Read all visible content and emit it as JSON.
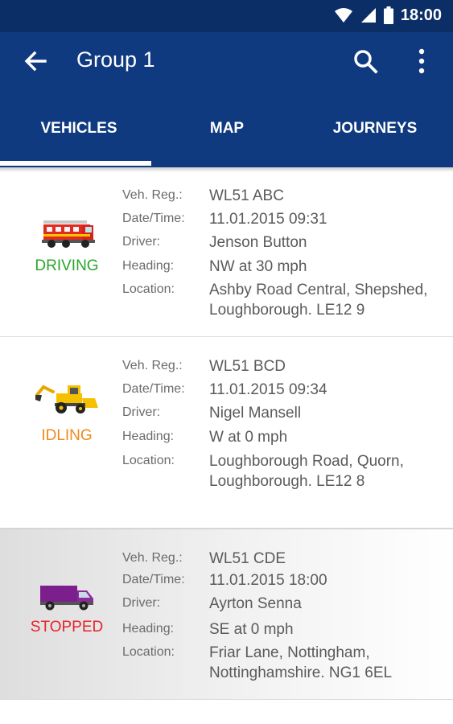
{
  "status_bar": {
    "time": "18:00",
    "icons": [
      "wifi-icon",
      "signal-icon",
      "battery-icon"
    ]
  },
  "app_bar": {
    "title": "Group 1",
    "back_icon": "arrow-back-icon",
    "search_icon": "search-icon",
    "menu_icon": "more-vert-icon"
  },
  "tabs": [
    {
      "label": "VEHICLES",
      "active": true
    },
    {
      "label": "MAP",
      "active": false
    },
    {
      "label": "JOURNEYS",
      "active": false
    }
  ],
  "field_labels": {
    "reg": "Veh. Reg.:",
    "datetime": "Date/Time:",
    "driver": "Driver:",
    "heading": "Heading:",
    "location": "Location:"
  },
  "vehicles": [
    {
      "icon": "fire-engine-icon",
      "status": "DRIVING",
      "status_color": "#2aa52a",
      "reg": "WL51 ABC",
      "datetime": "11.01.2015  09:31",
      "driver": "Jenson Button",
      "heading": "NW at 30 mph",
      "location_line1": "Ashby Road Central, Shepshed,",
      "location_line2": "Loughborough. LE12 9"
    },
    {
      "icon": "digger-icon",
      "status": "IDLING",
      "status_color": "#ef8a1a",
      "reg": "WL51 BCD",
      "datetime": "11.01.2015  09:34",
      "driver": "Nigel Mansell",
      "heading": "W at 0 mph",
      "location_line1": "Loughborough Road, Quorn,",
      "location_line2": "Loughborough. LE12 8"
    },
    {
      "icon": "van-icon",
      "status": "STOPPED",
      "status_color": "#e8222a",
      "reg": "WL51 CDE",
      "datetime": "11.01.2015  18:00",
      "driver": "Ayrton Senna",
      "heading": "SE at 0 mph",
      "location_line1": "Friar Lane, Nottingham,",
      "location_line2": "Nottinghamshire. NG1 6EL",
      "selected": true
    }
  ],
  "colors": {
    "app_bar": "#0f3a80",
    "status_bar": "#0c2e66",
    "value_text": "#5a5a5a",
    "label_text": "#6b6b6b"
  }
}
